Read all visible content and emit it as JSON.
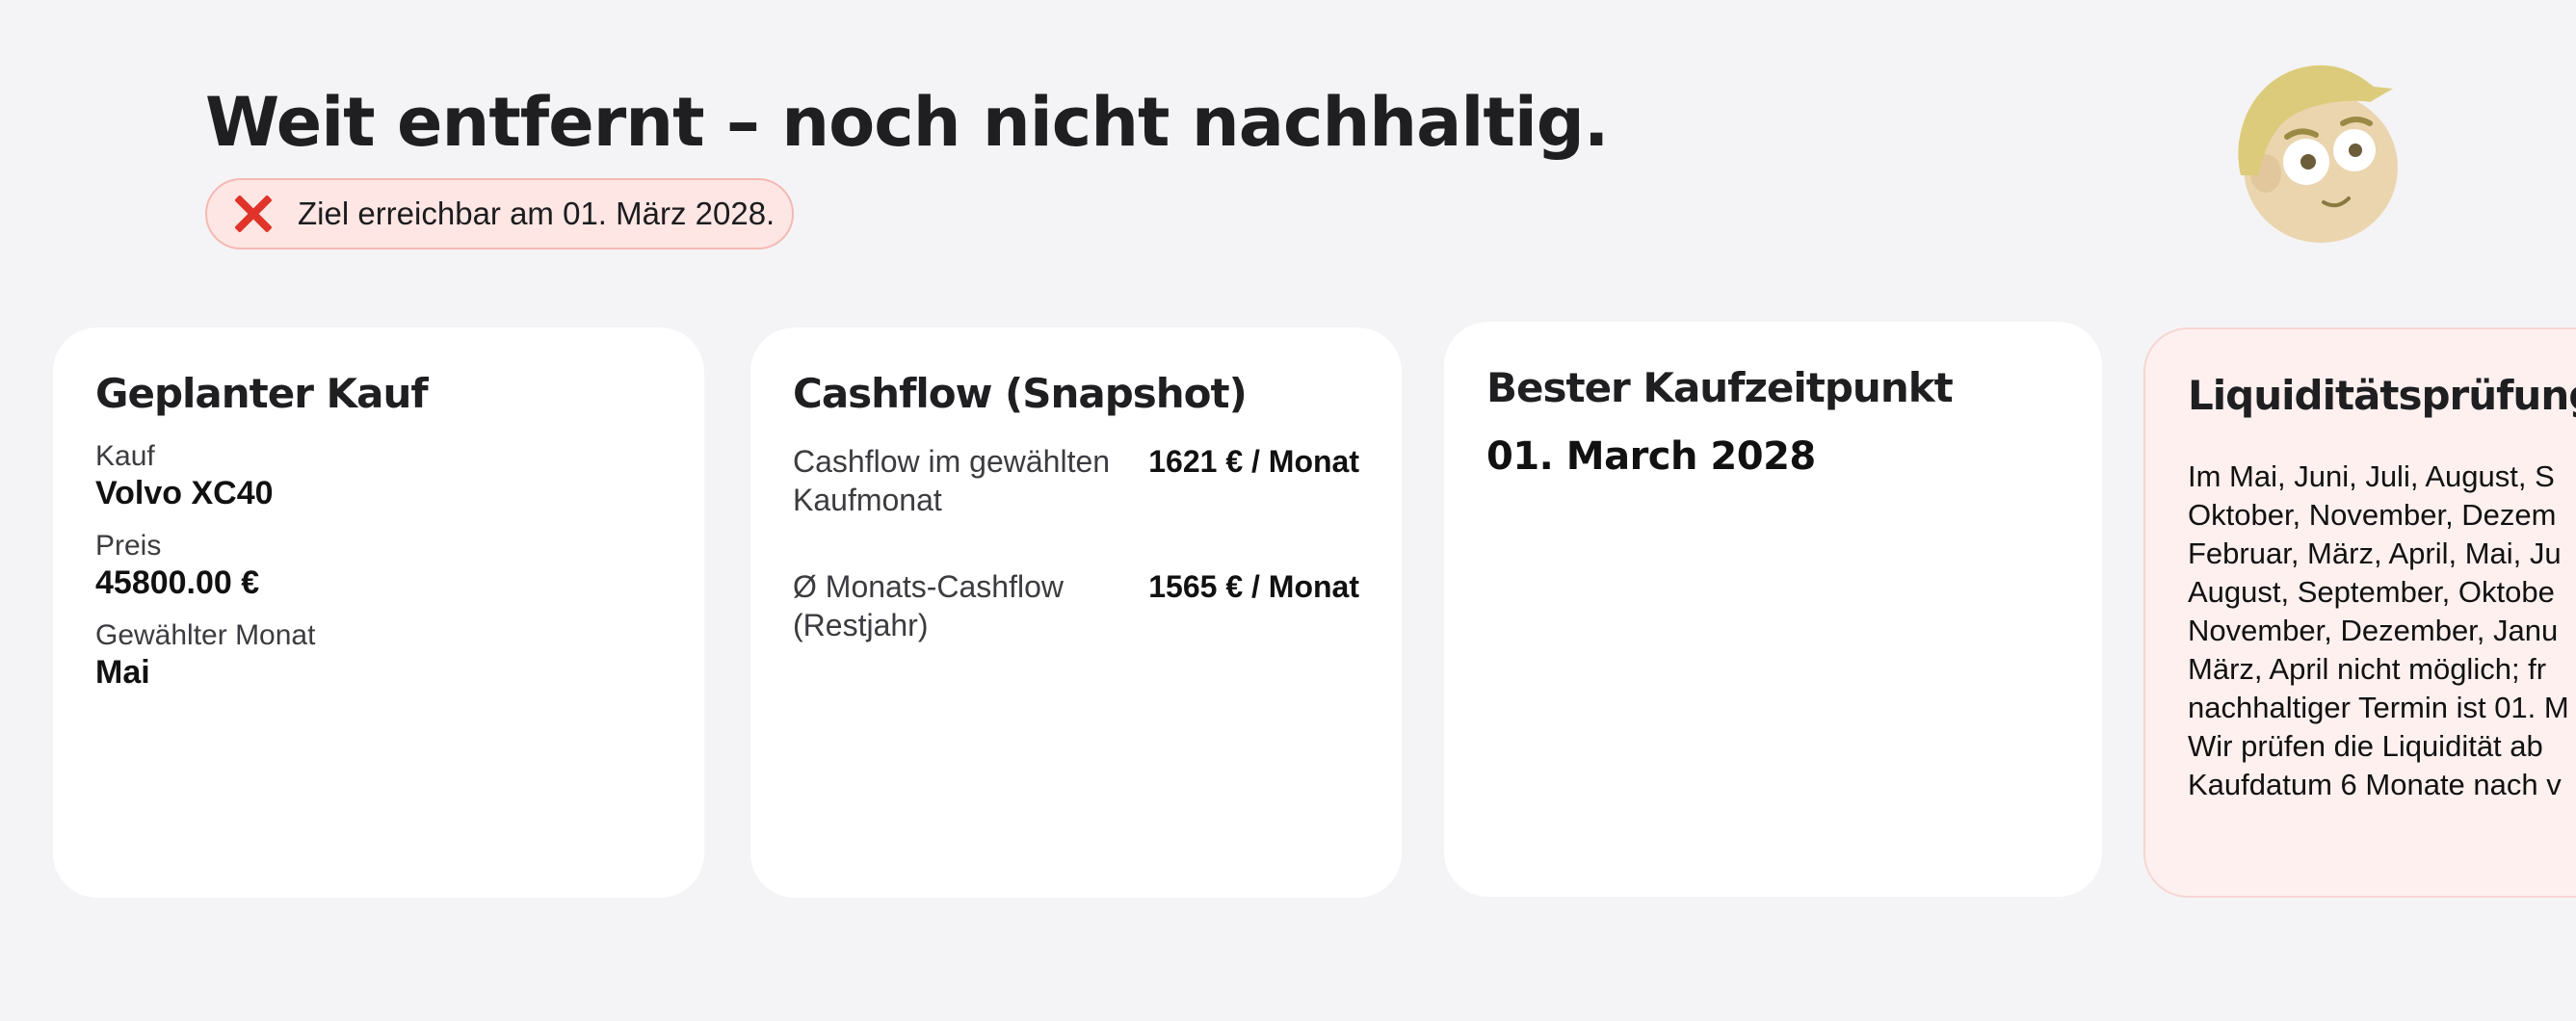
{
  "header": {
    "title": "Weit entfernt – noch nicht nachhaltig.",
    "status_badge": "Ziel erreichbar am 01. März 2028.",
    "status_icon": "x-icon",
    "status_color": "#e0342a"
  },
  "avatar": {
    "icon": "cartoon-face-avatar"
  },
  "purchase_card": {
    "title": "Geplanter Kauf",
    "fields": [
      {
        "label": "Kauf",
        "value": "Volvo XC40"
      },
      {
        "label": "Preis",
        "value": "45800.00 €"
      },
      {
        "label": "Gewählter Monat",
        "value": "Mai"
      }
    ]
  },
  "cashflow_card": {
    "title": "Cashflow (Snapshot)",
    "rows": [
      {
        "label": "Cashflow im gewählten Kaufmonat",
        "value": "1621 € / Monat"
      },
      {
        "label": "Ø Monats-Cashflow (Restjahr)",
        "value": "1565 € / Monat"
      }
    ]
  },
  "best_time_card": {
    "title": "Bester Kaufzeitpunkt",
    "date": "01. March 2028"
  },
  "liquidity_card": {
    "title": "Liquiditätsprüfung",
    "lines": [
      "Im Mai, Juni, Juli, August, S",
      "Oktober, November, Dezem",
      "Februar, März, April, Mai, Ju",
      "August, September, Oktobe",
      "November, Dezember, Janu",
      "März, April nicht möglich; fr",
      "nachhaltiger Termin ist 01. M",
      "Wir prüfen die Liquidität ab",
      "Kaufdatum 6 Monate nach v"
    ]
  }
}
